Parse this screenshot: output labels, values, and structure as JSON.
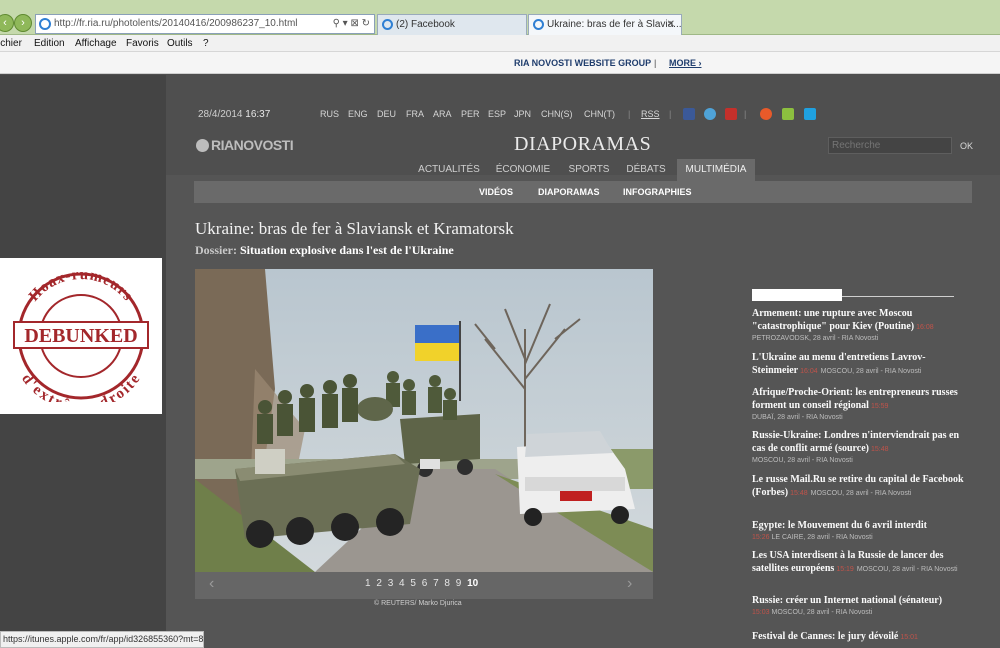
{
  "browser": {
    "address_url": "http://fr.ria.ru/photolents/20140416/200986237_10.html",
    "tabs": [
      {
        "label": "(2) Facebook"
      },
      {
        "label": "Ukraine: bras de fer à Slavia..."
      }
    ],
    "menu": [
      "ichier",
      "Edition",
      "Affichage",
      "Favoris",
      "Outils",
      "?"
    ],
    "status_url": "https://itunes.apple.com/fr/app/id326855360?mt=8"
  },
  "ria_bar": {
    "group": "RIA NOVOSTI WEBSITE GROUP",
    "sep": "|",
    "more": "MORE ›"
  },
  "header": {
    "date": "28/4/2014",
    "time": "16:37",
    "languages": [
      "RUS",
      "ENG",
      "DEU",
      "FRA",
      "ARA",
      "PER",
      "ESP",
      "JPN",
      "CHN(S)",
      "CHN(T)"
    ],
    "rss": "RSS",
    "logo": "RIANOVOSTI",
    "section_title": "DIAPORAMAS",
    "search_placeholder": "Recherche",
    "search_ok": "OK"
  },
  "nav": {
    "items": [
      "ACTUALITÉS",
      "ÉCONOMIE",
      "SPORTS",
      "DÉBATS",
      "MULTIMÉDIA"
    ],
    "active": "MULTIMÉDIA",
    "sub_items": [
      "VIDÉOS",
      "DIAPORAMAS",
      "INFOGRAPHIES"
    ]
  },
  "article": {
    "title": "Ukraine: bras de fer à Slaviansk et Kramatorsk",
    "dossier_label": "Dossier:",
    "dossier_value": "Situation explosive dans l'est de l'Ukraine",
    "pages": [
      "1",
      "2",
      "3",
      "4",
      "5",
      "6",
      "7",
      "8",
      "9",
      "10"
    ],
    "current_page": "10",
    "credit": "© REUTERS/ Marko Djurica",
    "arrow_prev": "‹",
    "arrow_next": "›"
  },
  "stamp": {
    "top": "Hoax-rumeurs",
    "center": "DEBUNKED",
    "bottom": "d'extrême-droite"
  },
  "news": [
    {
      "headline": "Armement: une rupture avec Moscou \"catastrophique\" pour Kiev (Poutine)",
      "time": "16:08",
      "meta": "PETROZAVODSK, 28 avril - RIA Novosti"
    },
    {
      "headline": "L'Ukraine au menu d'entretiens Lavrov-Steinmeier",
      "time": "16:04",
      "meta": "MOSCOU, 28 avril - RIA Novosti"
    },
    {
      "headline": "Afrique/Proche-Orient: les entrepreneurs russes forment un conseil régional",
      "time": "15:59",
      "meta": "DUBAÏ, 28 avril - RIA Novosti"
    },
    {
      "headline": "Russie-Ukraine: Londres n'interviendrait pas en cas de conflit armé (source)",
      "time": "15:48",
      "meta": "MOSCOU, 28 avril - RIA Novosti"
    },
    {
      "headline": "Le russe Mail.Ru se retire du capital de Facebook (Forbes)",
      "time": "15:48",
      "meta": "MOSCOU, 28 avril - RIA Novosti"
    },
    {
      "headline": "Egypte: le Mouvement du 6 avril interdit",
      "time": "15:26",
      "meta": "LE CAIRE, 28 avril - RIA Novosti"
    },
    {
      "headline": "Les USA interdisent à la Russie de lancer des satellites européens",
      "time": "15:19",
      "meta": "MOSCOU, 28 avril - RIA Novosti"
    },
    {
      "headline": "Russie: créer un Internet national (sénateur)",
      "time": "15:03",
      "meta": "MOSCOU, 28 avril - RIA Novosti"
    },
    {
      "headline": "Festival de Cannes: le jury dévoilé",
      "time": "15:01",
      "meta": ""
    }
  ]
}
